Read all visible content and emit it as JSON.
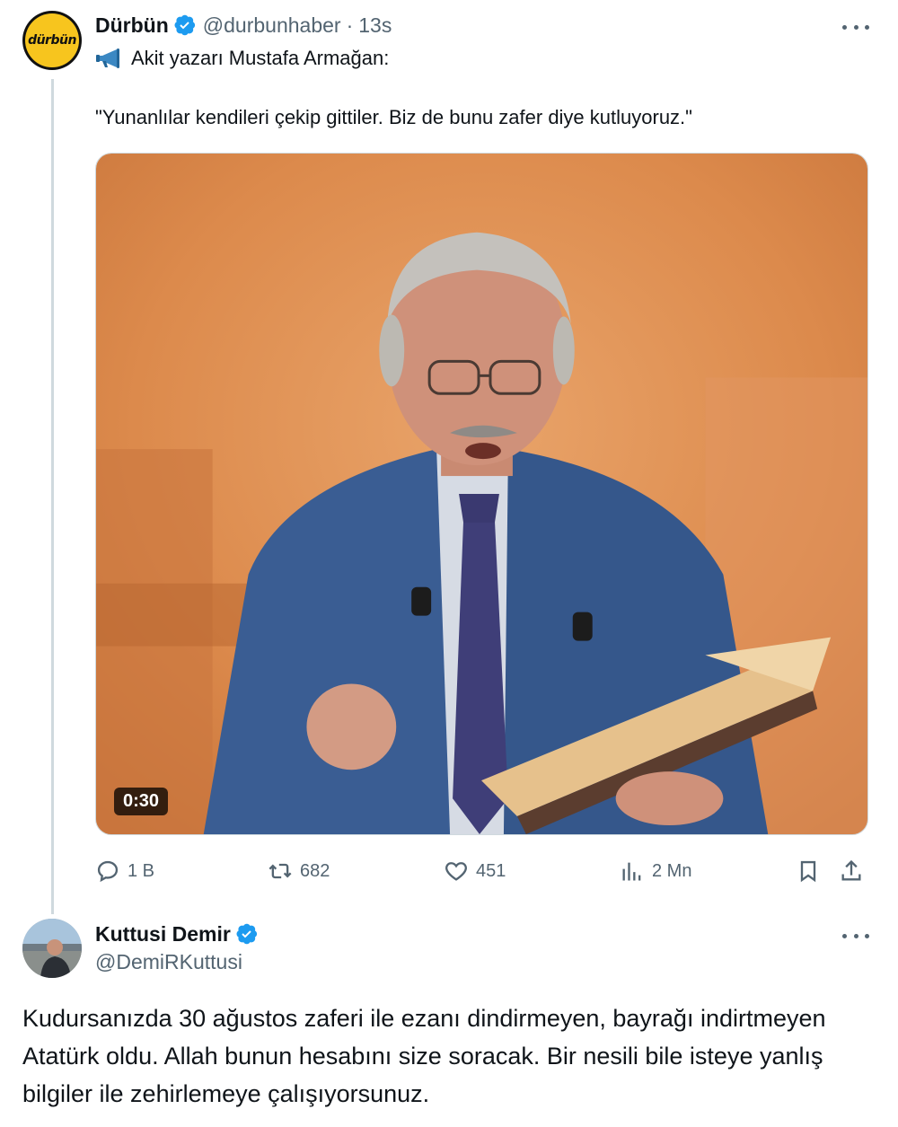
{
  "tweet1": {
    "author_name": "Dürbün",
    "avatar_text": "dürbün",
    "handle": "@durbunhaber",
    "separator": "·",
    "time": "13s",
    "line1": "Akit yazarı Mustafa Armağan:",
    "line2": "\"Yunanlılar kendileri çekip gittiler. Biz de bunu zafer diye kutluyoruz.\"",
    "video_duration": "0:30",
    "replies": "1 B",
    "retweets": "682",
    "likes": "451",
    "views": "2 Mn"
  },
  "tweet2": {
    "author_name": "Kuttusi Demir",
    "handle": "@DemiRKuttusi",
    "text": "Kudursanızda 30 ağustos zaferi ile ezanı dindirmeyen, bayrağı indirtmeyen Atatürk oldu. Allah bunun hesabını size soracak. Bir nesili bile isteye yanlış bilgiler ile zehirlemeye çalışıyorsunuz."
  },
  "colors": {
    "verified_blue": "#1d9bf0",
    "secondary_text": "#536471",
    "primary_text": "#0f1419",
    "thread_line": "#cfd9de",
    "logo_yellow": "#f7c51e"
  },
  "icons": {
    "megaphone": "megaphone-icon",
    "reply": "reply-icon",
    "retweet": "retweet-icon",
    "like": "heart-icon",
    "views": "views-icon",
    "bookmark": "bookmark-icon",
    "share": "share-icon",
    "more": "more-icon",
    "verified": "verified-badge-icon"
  }
}
